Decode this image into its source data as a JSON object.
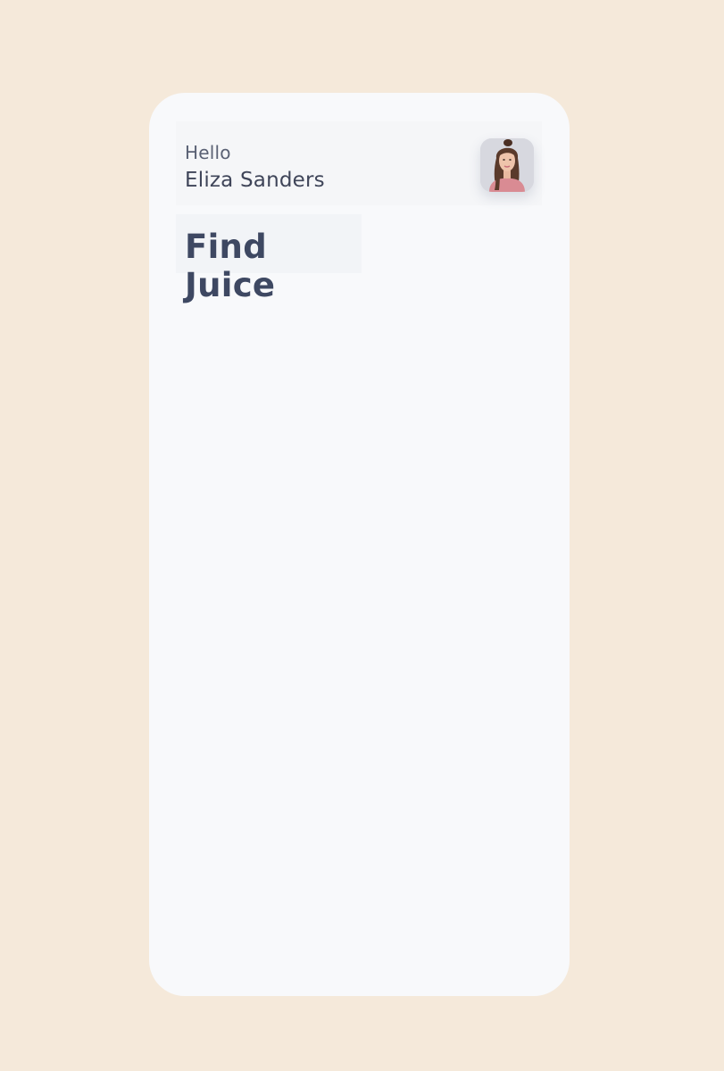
{
  "header": {
    "greeting": "Hello",
    "user_name": "Eliza Sanders",
    "avatar": "user-avatar-photo"
  },
  "main": {
    "title": "Find Juice"
  },
  "colors": {
    "background": "#f5e9da",
    "card": "#f8f9fb",
    "text_primary": "#3e4862",
    "text_secondary": "#5a6174"
  }
}
